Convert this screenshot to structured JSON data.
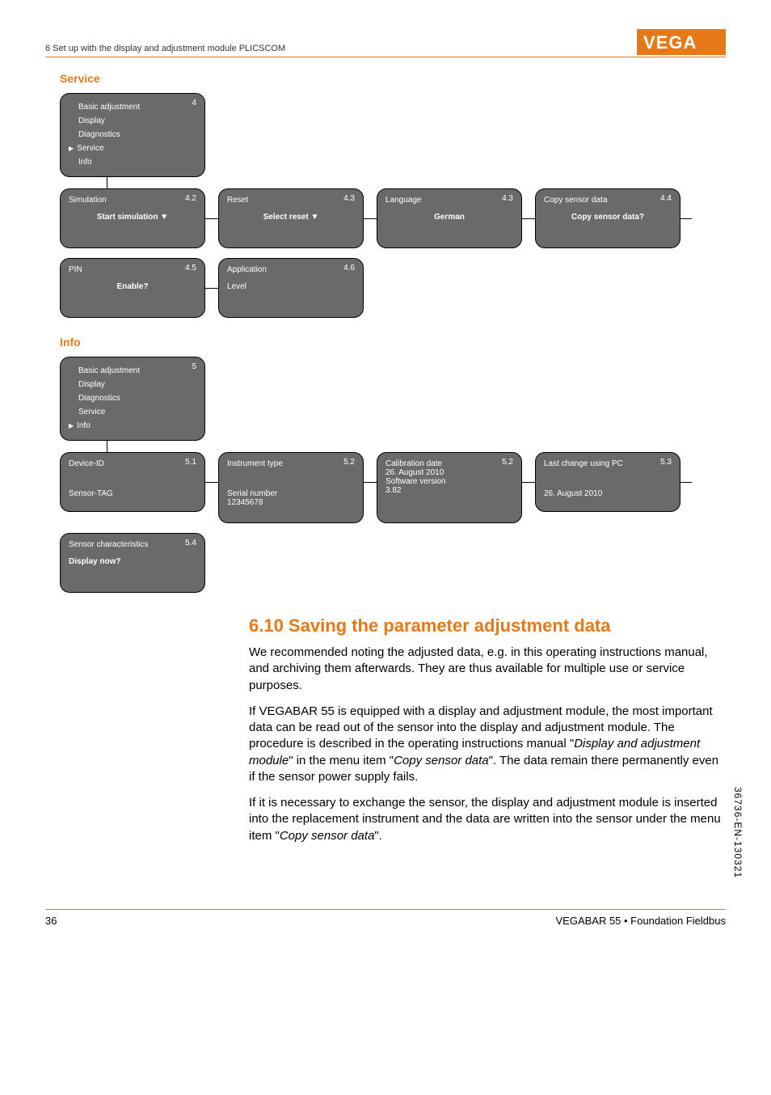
{
  "header": {
    "breadcrumb": "6 Set up with the display and adjustment module PLICSCOM"
  },
  "sections": {
    "service": {
      "title": "Service",
      "menu": {
        "num": "4",
        "items": [
          "Basic adjustment",
          "Display",
          "Diagnostics",
          "Service",
          "Info"
        ],
        "selected": "Service"
      },
      "screens_row1": [
        {
          "num": "4.2",
          "title": "Simulation",
          "body": "Start simulation ▼",
          "bold": true,
          "center": true
        },
        {
          "num": "4.3",
          "title": "Reset",
          "body": "Select reset ▼",
          "bold": true,
          "center": true
        },
        {
          "num": "4.3",
          "title": "Language",
          "body": "German",
          "bold": true,
          "center": true
        },
        {
          "num": "4.4",
          "title": "Copy sensor data",
          "body": "Copy sensor data?",
          "bold": true,
          "center": true
        }
      ],
      "screens_row2": [
        {
          "num": "4.5",
          "title": "PIN",
          "body": "Enable?",
          "bold": true,
          "center": true
        },
        {
          "num": "4.6",
          "title": "Application",
          "body": "Level",
          "bold": false,
          "center": false
        }
      ]
    },
    "info": {
      "title": "Info",
      "menu": {
        "num": "5",
        "items": [
          "Basic adjustment",
          "Display",
          "Diagnostics",
          "Service",
          "Info"
        ],
        "selected": "Info"
      },
      "screens_row1": [
        {
          "num": "5.1",
          "title": "Device-ID",
          "body": "Sensor-TAG",
          "bold": false,
          "center": false
        },
        {
          "num": "5.2",
          "title": "Instrument type",
          "body2": "Serial number",
          "body3": "12345678"
        },
        {
          "num": "5.2",
          "title": "Calibration date",
          "l2": "26. August 2010",
          "l3": "Software version",
          "l4": "3.82"
        },
        {
          "num": "5.3",
          "title": "Last change using PC",
          "body": "26. August 2010",
          "bold": false,
          "center": false,
          "spaced": true
        }
      ],
      "screens_row2": [
        {
          "num": "5.4",
          "title": "Sensor characteristics",
          "body": "Display now?",
          "bold": true,
          "center": false
        }
      ]
    }
  },
  "content": {
    "h2": "6.10  Saving the parameter adjustment data",
    "p1": "We recommended noting the adjusted data, e.g. in this operating instructions manual, and archiving them afterwards. They are thus available for multiple use or service purposes.",
    "p2a": "If VEGABAR 55 is equipped with a display and adjustment module, the most important data can be read out of the sensor into the display and adjustment module. The procedure is described in the operating instructions manual \"",
    "p2i1": "Display and adjustment module",
    "p2b": "\" in the menu item \"",
    "p2i2": "Copy sensor data",
    "p2c": "\". The data remain there permanently even if the sensor power supply fails.",
    "p3a": "If it is necessary to exchange the sensor, the display and adjustment module is inserted into the replacement instrument and the data are written into the sensor under the menu item \"",
    "p3i": "Copy sensor data",
    "p3b": "\"."
  },
  "footer": {
    "page": "36",
    "doc": "VEGABAR 55 • Foundation Fieldbus"
  },
  "sidecode": "36736-EN-130321"
}
